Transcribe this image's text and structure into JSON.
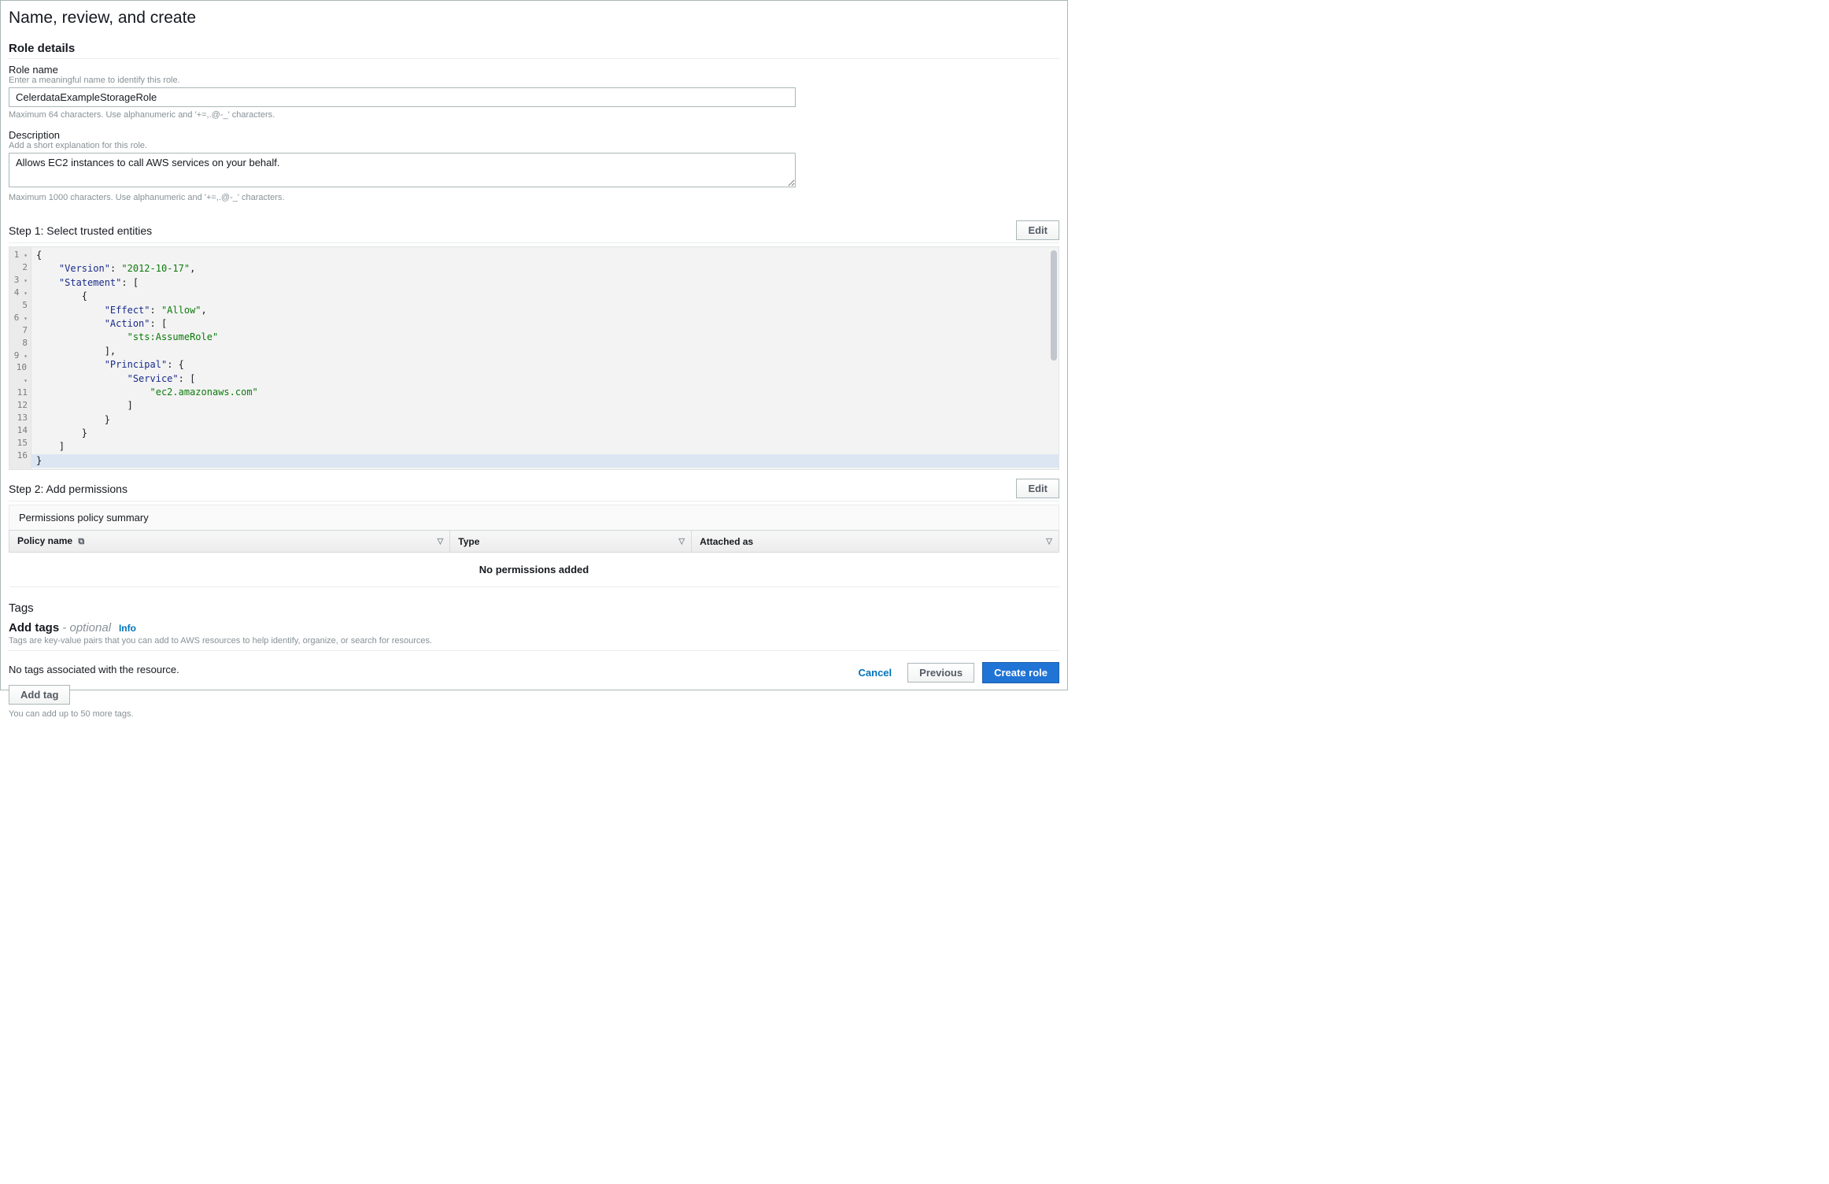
{
  "page_title": "Name, review, and create",
  "role_details": {
    "heading": "Role details",
    "role_name": {
      "label": "Role name",
      "hint": "Enter a meaningful name to identify this role.",
      "value": "CelerdataExampleStorageRole",
      "help": "Maximum 64 characters. Use alphanumeric and '+=,.@-_' characters."
    },
    "description": {
      "label": "Description",
      "hint": "Add a short explanation for this role.",
      "value": "Allows EC2 instances to call AWS services on your behalf.",
      "help": "Maximum 1000 characters. Use alphanumeric and '+=,.@-_' characters."
    }
  },
  "step1": {
    "title": "Step 1: Select trusted entities",
    "edit_label": "Edit",
    "policy_json": {
      "Version": "2012-10-17",
      "Statement": [
        {
          "Effect": "Allow",
          "Action": [
            "sts:AssumeRole"
          ],
          "Principal": {
            "Service": [
              "ec2.amazonaws.com"
            ]
          }
        }
      ]
    },
    "lines": [
      {
        "n": 1,
        "fold": true
      },
      {
        "n": 2
      },
      {
        "n": 3,
        "fold": true
      },
      {
        "n": 4,
        "fold": true
      },
      {
        "n": 5
      },
      {
        "n": 6,
        "fold": true
      },
      {
        "n": 7
      },
      {
        "n": 8
      },
      {
        "n": 9,
        "fold": true
      },
      {
        "n": 10,
        "fold": true
      },
      {
        "n": 11
      },
      {
        "n": 12
      },
      {
        "n": 13
      },
      {
        "n": 14
      },
      {
        "n": 15
      },
      {
        "n": 16
      }
    ]
  },
  "step2": {
    "title": "Step 2: Add permissions",
    "edit_label": "Edit",
    "summary_label": "Permissions policy summary",
    "columns": {
      "policy_name": "Policy name",
      "type": "Type",
      "attached_as": "Attached as"
    },
    "empty_text": "No permissions added"
  },
  "tags": {
    "heading": "Tags",
    "add_tags": "Add tags",
    "optional": " - optional",
    "info": "Info",
    "desc": "Tags are key-value pairs that you can add to AWS resources to help identify, organize, or search for resources.",
    "no_tags": "No tags associated with the resource.",
    "add_tag_btn": "Add tag",
    "help": "You can add up to 50 more tags."
  },
  "footer": {
    "cancel": "Cancel",
    "previous": "Previous",
    "create": "Create role"
  }
}
